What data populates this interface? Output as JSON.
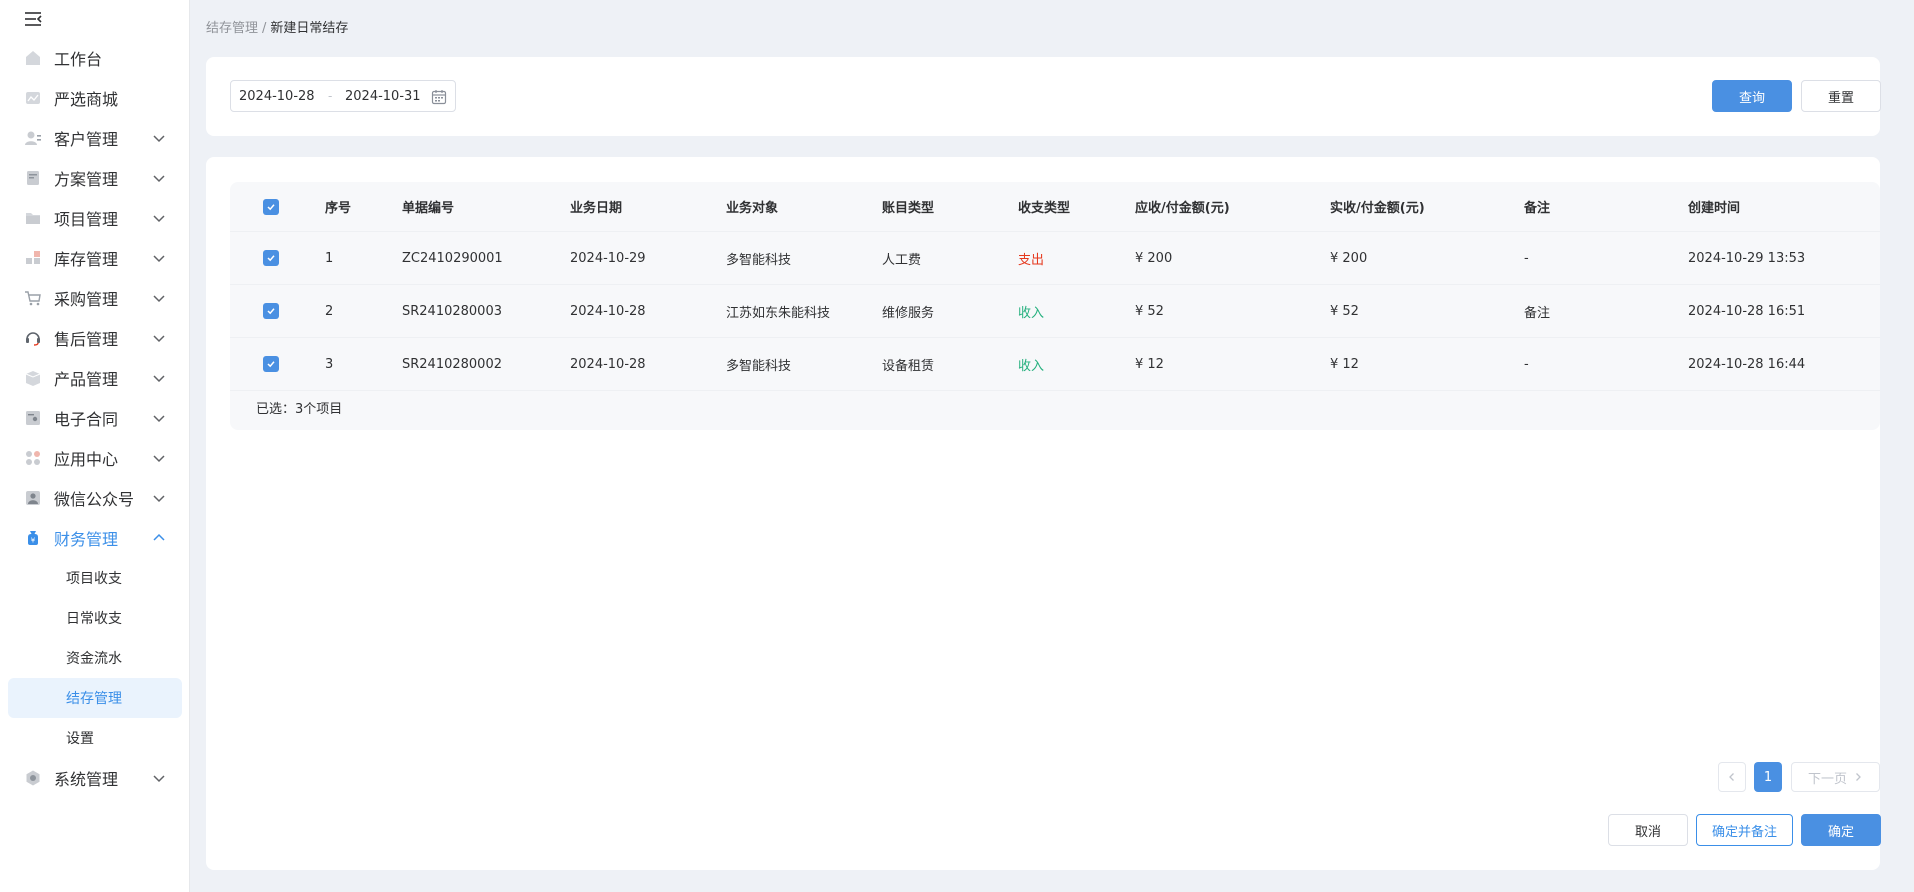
{
  "sidebar": {
    "items": [
      {
        "label": "工作台",
        "icon": "home-icon",
        "expandable": false
      },
      {
        "label": "严选商城",
        "icon": "store-icon",
        "expandable": false
      },
      {
        "label": "客户管理",
        "icon": "customer-icon",
        "expandable": true
      },
      {
        "label": "方案管理",
        "icon": "document-icon",
        "expandable": true
      },
      {
        "label": "项目管理",
        "icon": "folder-icon",
        "expandable": true
      },
      {
        "label": "库存管理",
        "icon": "inventory-icon",
        "expandable": true
      },
      {
        "label": "采购管理",
        "icon": "cart-icon",
        "expandable": true
      },
      {
        "label": "售后管理",
        "icon": "headset-icon",
        "expandable": true
      },
      {
        "label": "产品管理",
        "icon": "box-icon",
        "expandable": true
      },
      {
        "label": "电子合同",
        "icon": "contract-icon",
        "expandable": true
      },
      {
        "label": "应用中心",
        "icon": "apps-icon",
        "expandable": true
      },
      {
        "label": "微信公众号",
        "icon": "wechat-user-icon",
        "expandable": true
      },
      {
        "label": "财务管理",
        "icon": "money-bag-icon",
        "expandable": true,
        "active": true
      }
    ],
    "finance_subitems": [
      "项目收支",
      "日常收支",
      "资金流水",
      "结存管理",
      "设置"
    ],
    "system_item": "系统管理"
  },
  "breadcrumb": {
    "parent": "结存管理",
    "separator": "/",
    "current": "新建日常结存"
  },
  "search": {
    "date_start": "2024-10-28",
    "date_sep": "-",
    "date_end": "2024-10-31",
    "query_label": "查询",
    "reset_label": "重置"
  },
  "table": {
    "headers": [
      "序号",
      "单据编号",
      "业务日期",
      "业务对象",
      "账目类型",
      "收支类型",
      "应收/付金额(元)",
      "实收/付金额(元)",
      "备注",
      "创建时间"
    ],
    "rows": [
      {
        "no": "1",
        "code": "ZC2410290001",
        "date": "2024-10-29",
        "target": "多智能科技",
        "account": "人工费",
        "type": "支出",
        "due": "¥ 200",
        "paid": "¥ 200",
        "remark": "-",
        "created": "2024-10-29 13:53"
      },
      {
        "no": "2",
        "code": "SR2410280003",
        "date": "2024-10-28",
        "target": "江苏如东朱能科技",
        "account": "维修服务",
        "type": "收入",
        "due": "¥ 52",
        "paid": "¥ 52",
        "remark": "备注",
        "created": "2024-10-28 16:51"
      },
      {
        "no": "3",
        "code": "SR2410280002",
        "date": "2024-10-28",
        "target": "多智能科技",
        "account": "设备租赁",
        "type": "收入",
        "due": "¥ 12",
        "paid": "¥ 12",
        "remark": "-",
        "created": "2024-10-28 16:44"
      }
    ],
    "selected_text": "已选：3个项目"
  },
  "pagination": {
    "current_page": "1",
    "next_label": "下一页"
  },
  "footer": {
    "cancel_label": "取消",
    "confirm_remark_label": "确定并备注",
    "confirm_label": "确定"
  },
  "colors": {
    "primary": "#4a90e2",
    "expense": "#e5391e",
    "income": "#25b07e"
  }
}
